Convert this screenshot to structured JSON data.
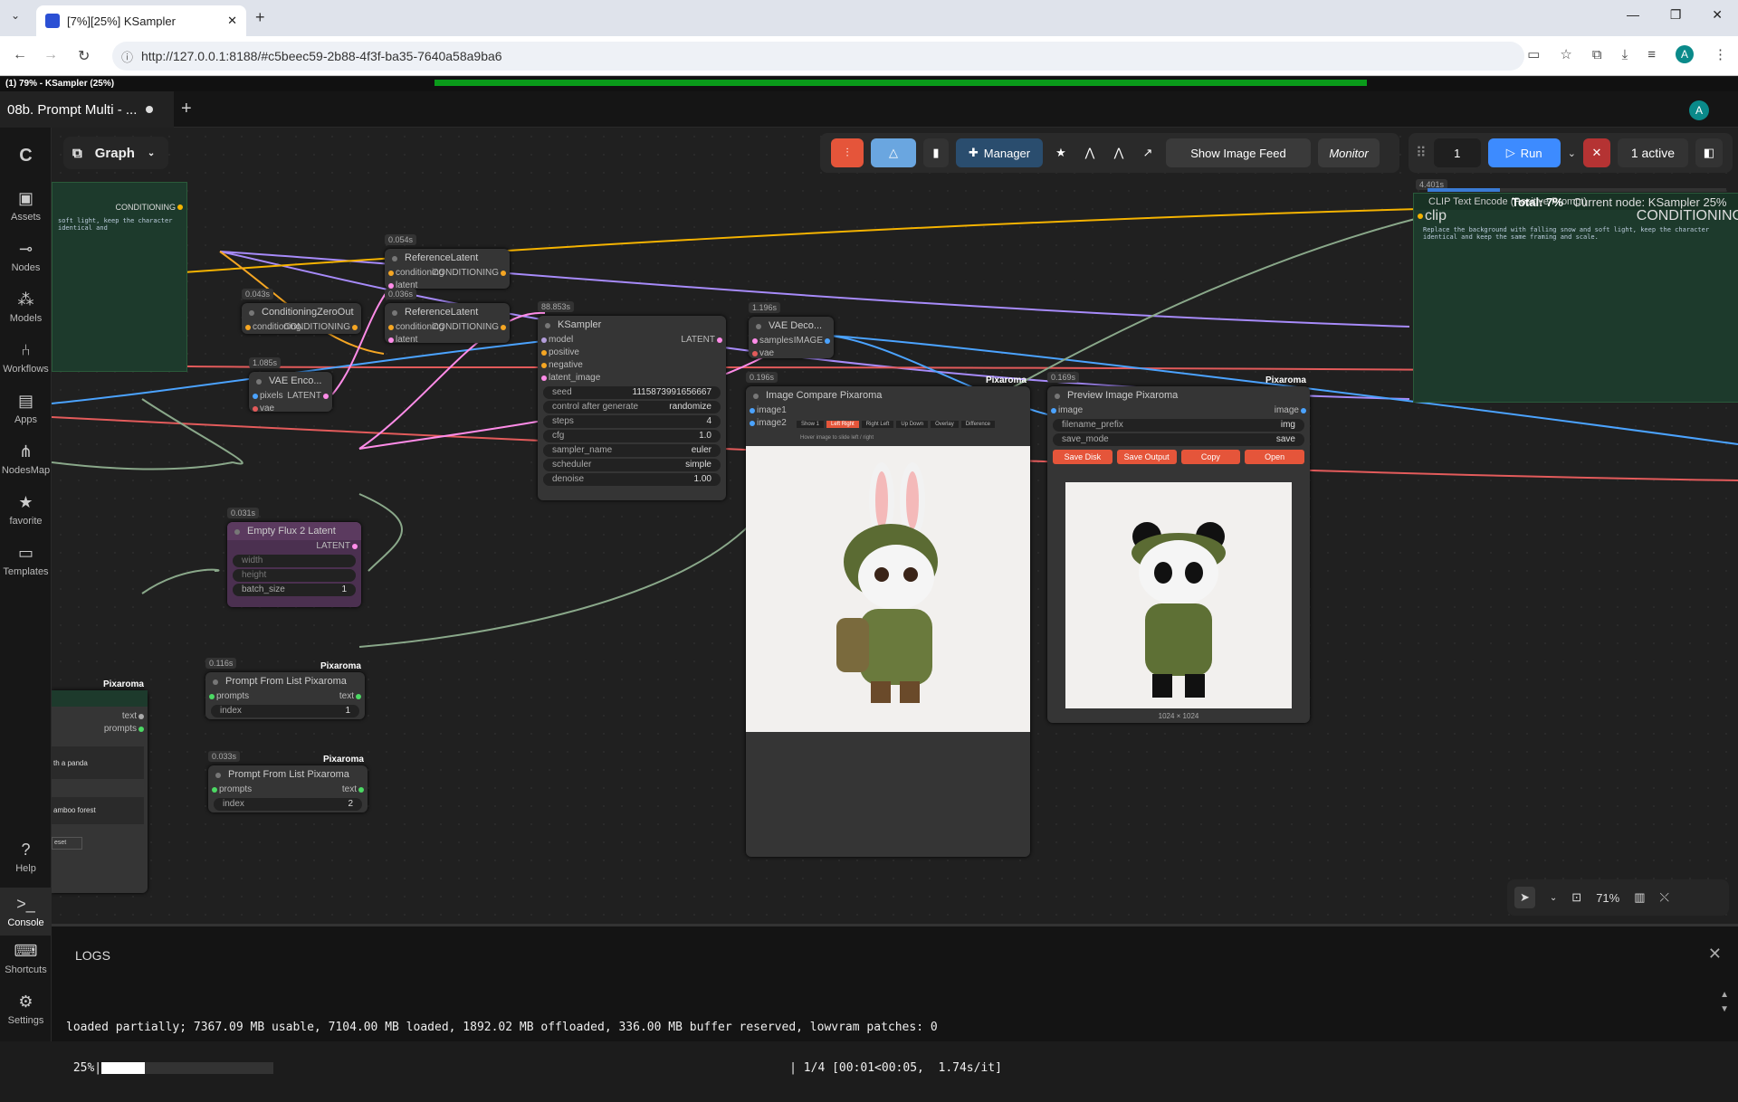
{
  "browser": {
    "tab_title": "[7%][25%] KSampler",
    "url": "http://127.0.0.1:8188/#c5beec59-2b88-4f3f-ba35-7640a58a9ba6",
    "profile_initial": "A"
  },
  "progress_label": "(1) 79% - KSampler (25%)",
  "workflow": {
    "tab_name": "08b. Prompt Multi - ...",
    "user_initial": "A"
  },
  "sidebar": [
    {
      "label": "Assets",
      "icon": "image-icon"
    },
    {
      "label": "Nodes",
      "icon": "nodes-icon"
    },
    {
      "label": "Models",
      "icon": "models-icon"
    },
    {
      "label": "Workflows",
      "icon": "workflows-icon"
    },
    {
      "label": "Apps",
      "icon": "apps-icon"
    },
    {
      "label": "NodesMap",
      "icon": "nodesmap-icon"
    },
    {
      "label": "favorite",
      "icon": "star-icon"
    },
    {
      "label": "Templates",
      "icon": "templates-icon"
    },
    {
      "label": "Help",
      "icon": "help-icon"
    },
    {
      "label": "Console",
      "icon": "console-icon"
    },
    {
      "label": "Shortcuts",
      "icon": "keyboard-icon"
    },
    {
      "label": "Settings",
      "icon": "gear-icon"
    }
  ],
  "graph_label": "Graph",
  "toolbar": {
    "manager": "Manager",
    "show_image_feed": "Show Image Feed",
    "monitor": "Monitor",
    "queue_count": "1",
    "run": "Run",
    "active": "1 active"
  },
  "status": {
    "total": "Total: 7%",
    "current": "Current node: KSampler 25%"
  },
  "nodes": {
    "cond_left": {
      "out": "CONDITIONING",
      "text": "soft light, keep the character identical and"
    },
    "clip_text": {
      "time": "4.401s",
      "title": "CLIP Text Encode (Positive Prompt)",
      "in": "clip",
      "out": "CONDITIONING",
      "text": "Replace the background with falling snow and soft light, keep the character identical and keep the same framing and scale."
    },
    "ref1": {
      "time": "0.054s",
      "title": "ReferenceLatent",
      "in1": "conditioning",
      "out": "CONDITIONING",
      "in2": "latent"
    },
    "ref2": {
      "time": "0.036s",
      "title": "ReferenceLatent",
      "in1": "conditioning",
      "out": "CONDITIONING",
      "in2": "latent"
    },
    "zero": {
      "time": "0.043s",
      "title": "ConditioningZeroOut",
      "in": "conditioning",
      "out": "CONDITIONING"
    },
    "vaeenc": {
      "time": "1.085s",
      "title": "VAE Enco...",
      "in1": "pixels",
      "out": "LATENT",
      "in2": "vae"
    },
    "latent": {
      "time": "0.031s",
      "title": "Empty Flux 2 Latent",
      "out": "LATENT",
      "w1": "width",
      "w2": "height",
      "w3": "batch_size",
      "w3v": "1"
    },
    "ksampler": {
      "time": "88.853s",
      "title": "KSampler",
      "out": "LATENT",
      "inputs": [
        "model",
        "positive",
        "negative",
        "latent_image"
      ],
      "widgets": [
        [
          "seed",
          "1115873991656667"
        ],
        [
          "control after generate",
          "randomize"
        ],
        [
          "steps",
          "4"
        ],
        [
          "cfg",
          "1.0"
        ],
        [
          "sampler_name",
          "euler"
        ],
        [
          "scheduler",
          "simple"
        ],
        [
          "denoise",
          "1.00"
        ]
      ]
    },
    "vaedec": {
      "time": "1.196s",
      "title": "VAE Deco...",
      "in1": "samples",
      "out": "IMAGE",
      "in2": "vae"
    },
    "compare": {
      "time": "0.196s",
      "title": "Image Compare Pixaroma",
      "tag": "Pixaroma",
      "in1": "image1",
      "in2": "image2",
      "modes": [
        "Show 1",
        "Left Right",
        "Right Left",
        "Up Down",
        "Overlay",
        "Difference"
      ],
      "hint": "Hover image to slide left / right"
    },
    "preview": {
      "time": "0.169s",
      "title": "Preview Image Pixaroma",
      "tag": "Pixaroma",
      "in": "image",
      "out": "image",
      "prefix_label": "filename_prefix",
      "prefix_val": "img",
      "mode_label": "save_mode",
      "mode_val": "save",
      "buttons": [
        "Save Disk",
        "Save Output",
        "Copy",
        "Open"
      ],
      "size": "1024 × 1024"
    },
    "list1": {
      "time": "0.116s",
      "title": "Prompt From List Pixaroma",
      "tag": "Pixaroma",
      "in": "prompts",
      "out": "text",
      "idx_label": "index",
      "idx": "1"
    },
    "list2": {
      "time": "0.033s",
      "title": "Prompt From List Pixaroma",
      "tag": "Pixaroma",
      "in": "prompts",
      "out": "text",
      "idx_label": "index",
      "idx": "2"
    },
    "multi": {
      "tag": "Pixaroma",
      "out1": "text",
      "out2": "prompts",
      "p1": "th a panda",
      "p2": "amboo forest",
      "reset": "eset"
    }
  },
  "zoom": "71%",
  "console": {
    "title": "LOGS",
    "line1": "loaded partially; 7367.09 MB usable, 7104.00 MB loaded, 1892.02 MB offloaded, 336.00 MB buffer reserved, lowvram patches: 0",
    "line2_pct": " 25%|",
    "line2_rest": "| 1/4 [00:01<00:05,  1.74s/it]",
    "progress": 0.25
  }
}
